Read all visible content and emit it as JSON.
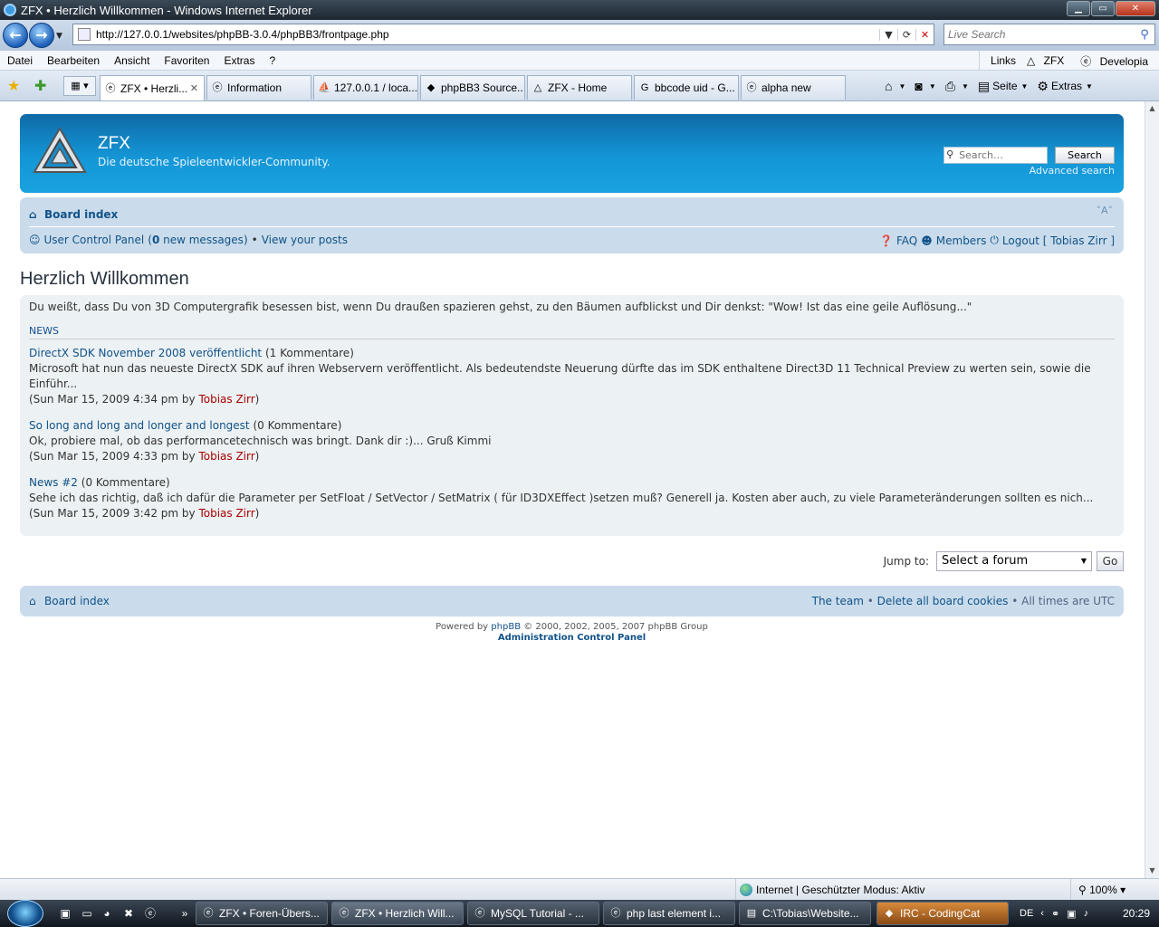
{
  "window": {
    "title": "ZFX • Herzlich Willkommen - Windows Internet Explorer",
    "buttons": {
      "minimize": "▁",
      "maximize": "▭",
      "close": "✕"
    }
  },
  "addressbar": {
    "url": "http://127.0.0.1/websites/phpBB-3.0.4/phpBB3/frontpage.php",
    "live_search_placeholder": "Live Search"
  },
  "menu": {
    "items": [
      "Datei",
      "Bearbeiten",
      "Ansicht",
      "Favoriten",
      "Extras",
      "?"
    ],
    "links_label": "Links",
    "links": [
      "ZFX",
      "Developia"
    ]
  },
  "tabs": [
    {
      "label": "ZFX • Herzli...",
      "active": true
    },
    {
      "label": "Information",
      "active": false
    },
    {
      "label": "127.0.0.1 / loca...",
      "active": false
    },
    {
      "label": "phpBB3 Source...",
      "active": false
    },
    {
      "label": "ZFX - Home",
      "active": false
    },
    {
      "label": "bbcode uid - G...",
      "active": false
    },
    {
      "label": "alpha new",
      "active": false
    }
  ],
  "commandbar": {
    "seite": "Seite",
    "extras": "Extras"
  },
  "forum": {
    "site_name": "ZFX",
    "site_description": "Die deutsche Spieleentwickler-Community.",
    "search_placeholder": "Search…",
    "search_button": "Search",
    "advanced_search": "Advanced search",
    "board_index": "Board index",
    "font_size_toggle": "A",
    "ucp": "User Control Panel",
    "new_messages_count": "0",
    "new_messages_text": "new messages",
    "view_posts": "View your posts",
    "faq": "FAQ",
    "members": "Members",
    "logout": "Logout [ Tobias Zirr ]",
    "page_title": "Herzlich Willkommen",
    "intro": "Du weißt, dass Du von 3D Computergrafik besessen bist, wenn Du draußen spazieren gehst, zu den Bäumen aufblickst und Dir denkst: \"Wow! Ist das eine geile Auflösung...\"",
    "news_heading": "NEWS",
    "news": [
      {
        "title": "DirectX SDK November 2008 veröffentlicht",
        "comments": "(1 Kommentare)",
        "excerpt": "Microsoft hat nun das neueste DirectX SDK auf ihren Webservern veröffentlicht. Als bedeutendste Neuerung dürfte das im SDK enthaltene Direct3D 11 Technical Preview zu werten sein, sowie die Einführ...",
        "date": "(Sun Mar 15, 2009 4:34 pm by ",
        "author": "Tobias Zirr"
      },
      {
        "title": "So long and long and longer and longest",
        "comments": "(0 Kommentare)",
        "excerpt": "Ok, probiere mal, ob das performancetechnisch was bringt. Dank dir :)... Gruß Kimmi",
        "date": "(Sun Mar 15, 2009 4:33 pm by ",
        "author": "Tobias Zirr"
      },
      {
        "title": "News #2",
        "comments": "(0 Kommentare)",
        "excerpt": "Sehe ich das richtig, daß ich dafür die Parameter per SetFloat / SetVector / SetMatrix ( für ID3DXEffect )setzen muß? Generell ja. Kosten aber auch, zu viele Parameteränderungen sollten es nich...",
        "date": "(Sun Mar 15, 2009 3:42 pm by ",
        "author": "Tobias Zirr"
      }
    ],
    "jump_to_label": "Jump to:",
    "jump_select": "Select a forum",
    "go_button": "Go",
    "footer_board_index": "Board index",
    "the_team": "The team",
    "delete_cookies": "Delete all board cookies",
    "times_utc": "All times are UTC",
    "powered_prefix": "Powered by",
    "powered_link": "phpBB",
    "powered_suffix": "© 2000, 2002, 2005, 2007 phpBB Group",
    "acp": "Administration Control Panel"
  },
  "statusbar": {
    "zone": "Internet | Geschützter Modus: Aktiv",
    "zoom": "100%"
  },
  "taskbar": {
    "tasks": [
      {
        "label": "ZFX • Foren-Übers..."
      },
      {
        "label": "ZFX • Herzlich Will..."
      },
      {
        "label": "MySQL Tutorial - ..."
      },
      {
        "label": "php last element i..."
      },
      {
        "label": "C:\\Tobias\\Website..."
      },
      {
        "label": "IRC - CodingCat"
      }
    ],
    "language": "DE",
    "clock": "20:29"
  },
  "colors": {
    "header_blue": "#1496d6",
    "nav_blue": "#cadceb",
    "link_blue": "#105289",
    "author_red": "#aa0000",
    "panel_bg": "#ecf1f3"
  }
}
